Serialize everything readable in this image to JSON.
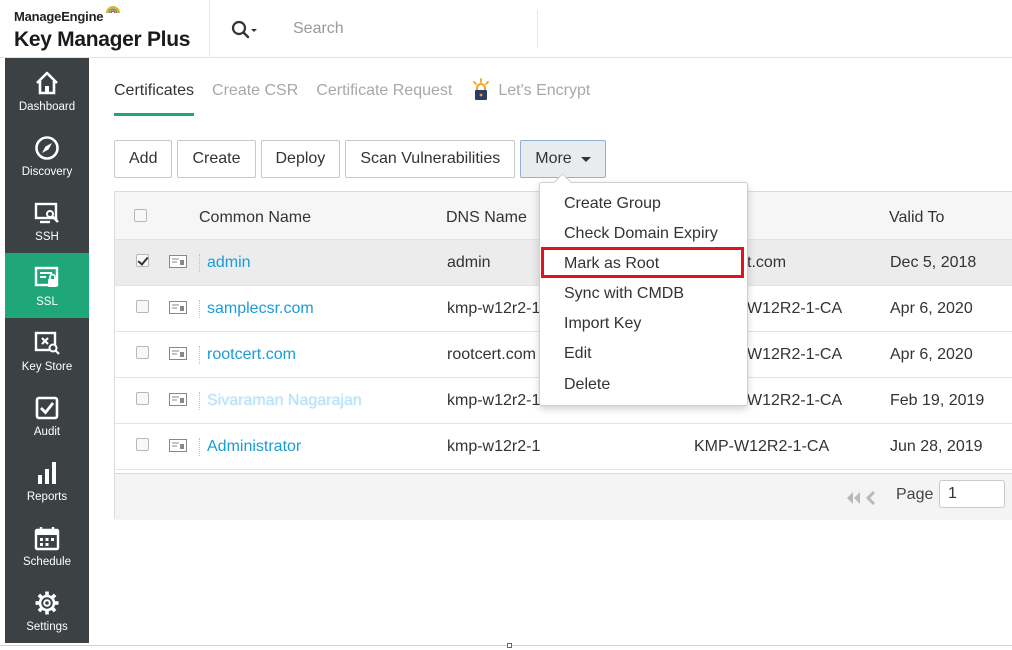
{
  "brand": {
    "company": "ManageEngine",
    "product": "Key Manager Plus",
    "accent": "#1fa77a"
  },
  "search": {
    "placeholder": "Search"
  },
  "sidebar": {
    "items": [
      {
        "label": "Dashboard",
        "icon": "home-icon"
      },
      {
        "label": "Discovery",
        "icon": "compass-icon"
      },
      {
        "label": "SSH",
        "icon": "ssh-icon"
      },
      {
        "label": "SSL",
        "icon": "ssl-certificate-icon",
        "active": true
      },
      {
        "label": "Key Store",
        "icon": "key-store-icon"
      },
      {
        "label": "Audit",
        "icon": "audit-check-icon"
      },
      {
        "label": "Reports",
        "icon": "bar-chart-icon"
      },
      {
        "label": "Schedule",
        "icon": "calendar-icon"
      },
      {
        "label": "Settings",
        "icon": "gear-icon"
      }
    ]
  },
  "tabs": [
    {
      "label": "Certificates",
      "active": true
    },
    {
      "label": "Create CSR"
    },
    {
      "label": "Certificate Request"
    },
    {
      "label": "Let's Encrypt"
    }
  ],
  "toolbar": {
    "add": "Add",
    "create": "Create",
    "deploy": "Deploy",
    "scan": "Scan Vulnerabilities",
    "more": "More"
  },
  "table": {
    "columns": {
      "common_name": "Common Name",
      "dns_name": "DNS Name",
      "valid_to": "Valid To"
    },
    "rows": [
      {
        "common_name": "admin",
        "dns_name": "admin",
        "issuer": "t.com",
        "valid_to": "Dec 5, 2018",
        "checked": true
      },
      {
        "common_name": "samplecsr.com",
        "dns_name": "kmp-w12r2-1",
        "issuer": "W12R2-1-CA",
        "valid_to": "Apr 6, 2020"
      },
      {
        "common_name": "rootcert.com",
        "dns_name": "rootcert.com",
        "issuer": "W12R2-1-CA",
        "valid_to": "Apr 6, 2020"
      },
      {
        "common_name": "Sivaraman Nagarajan",
        "dns_name": "kmp-w12r2-1",
        "issuer": "W12R2-1-CA",
        "valid_to": "Feb 19, 2019"
      },
      {
        "common_name": "Administrator",
        "dns_name": "kmp-w12r2-1",
        "issuer": "KMP-W12R2-1-CA",
        "valid_to": "Jun 28, 2019"
      }
    ]
  },
  "pagination": {
    "label": "Page",
    "value": "1"
  },
  "more_menu": {
    "items": [
      "Create Group",
      "Check Domain Expiry",
      "Mark as Root",
      "Sync with CMDB",
      "Import Key",
      "Edit",
      "Delete"
    ],
    "highlighted": "Mark as Root",
    "highlight_color": "#e0141e"
  }
}
